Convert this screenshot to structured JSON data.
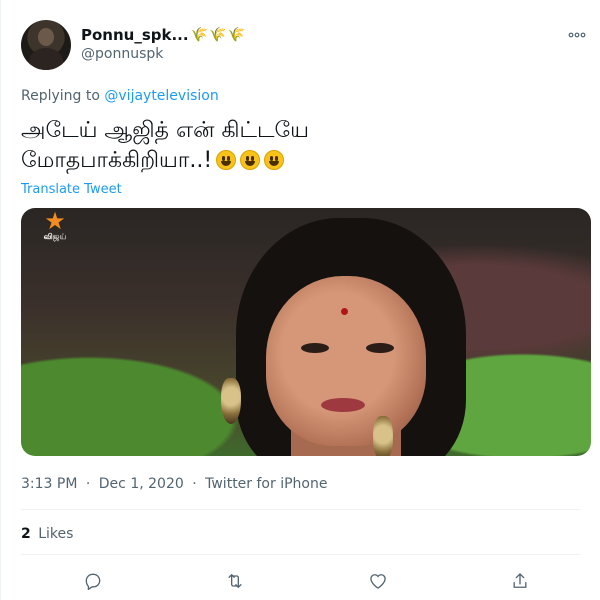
{
  "author": {
    "display_name": "Ponnu_spk...",
    "name_emoji": "🌾🌾🌾",
    "handle": "@ponnuspk"
  },
  "reply": {
    "prefix": "Replying to",
    "mention": "@vijaytelevision"
  },
  "tweet": {
    "line1": "அடேய் ஆஜித் என் கிட்டயே",
    "line2": "மோதபாக்கிறியா..!",
    "translate_label": "Translate Tweet"
  },
  "media": {
    "channel_logo_text": "விஜய்"
  },
  "meta": {
    "time": "3:13 PM",
    "date": "Dec 1, 2020",
    "separator": "·",
    "source": "Twitter for iPhone"
  },
  "stats": {
    "likes_count": "2",
    "likes_label": "Likes"
  },
  "actions": {
    "icons": [
      "reply-icon",
      "retweet-icon",
      "like-icon",
      "share-icon"
    ]
  },
  "colors": {
    "accent": "#1d9bf0",
    "secondary_text": "#536471",
    "primary_text": "#0f1419",
    "divider": "#eff3f4"
  }
}
